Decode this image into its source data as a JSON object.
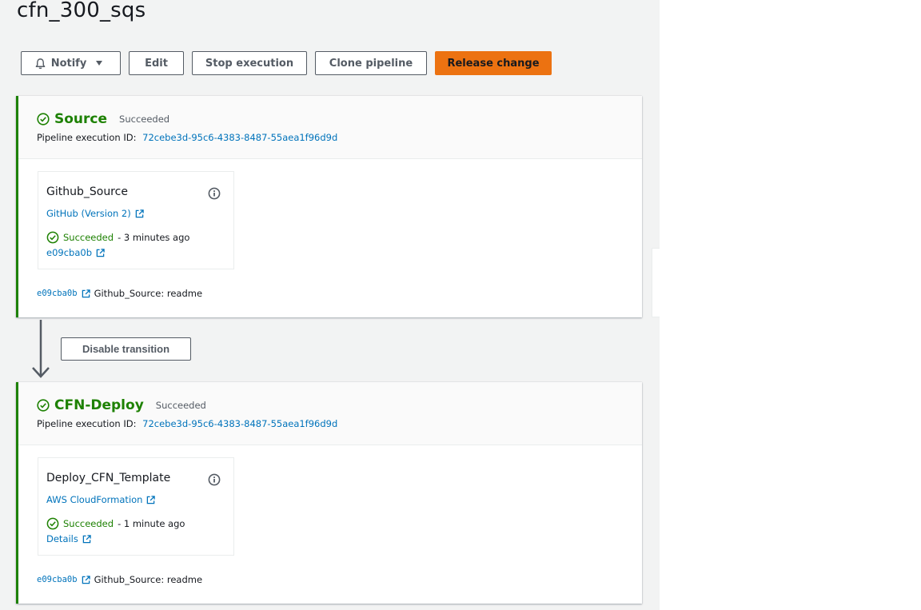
{
  "pipeline": {
    "title": "cfn_300_sqs"
  },
  "toolbar": {
    "notify_label": "Notify",
    "edit_label": "Edit",
    "stop_label": "Stop execution",
    "clone_label": "Clone pipeline",
    "release_label": "Release change"
  },
  "exec_id_label": "Pipeline execution ID:",
  "stages": [
    {
      "name": "Source",
      "status": "Succeeded",
      "execution_id": "72cebe3d-95c6-4383-8487-55aea1f96d9d",
      "action": {
        "name": "Github_Source",
        "provider": "GitHub (Version 2)",
        "status": "Succeeded",
        "time": "- 3 minutes ago",
        "link": "e09cba0b"
      },
      "revision": {
        "id": "e09cba0b",
        "message": "Github_Source: readme"
      }
    },
    {
      "name": "CFN-Deploy",
      "status": "Succeeded",
      "execution_id": "72cebe3d-95c6-4383-8487-55aea1f96d9d",
      "action": {
        "name": "Deploy_CFN_Template",
        "provider": "AWS CloudFormation",
        "status": "Succeeded",
        "time": "- 1 minute ago",
        "link": "Details"
      },
      "revision": {
        "id": "e09cba0b",
        "message": "Github_Source: readme"
      }
    }
  ],
  "transition": {
    "label": "Disable transition"
  },
  "icons": {
    "notify": "bell-icon",
    "dropdown": "caret-down-icon",
    "status": "check-circle-icon",
    "info": "info-icon",
    "external": "external-link-icon",
    "arrow": "arrow-down-icon"
  },
  "colors": {
    "success": "#1d8102",
    "link": "#0073bb",
    "primary": "#ec7211",
    "background": "#f2f3f3"
  }
}
